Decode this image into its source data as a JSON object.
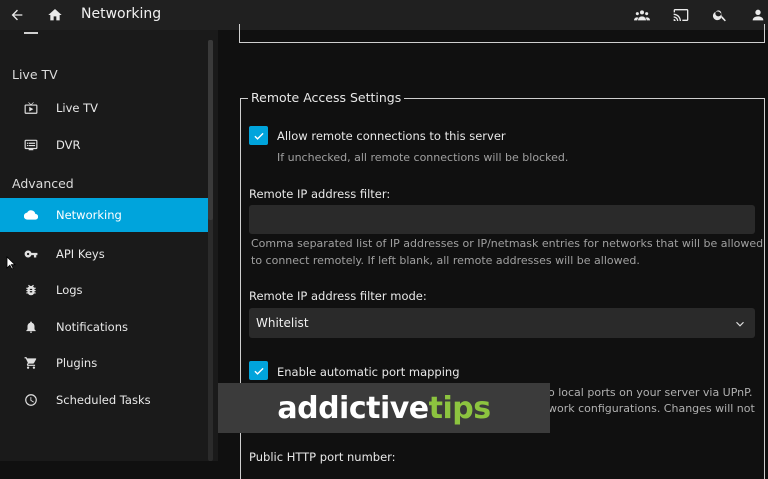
{
  "header": {
    "title": "Networking"
  },
  "sidebar": {
    "sections": [
      {
        "label": "Live TV"
      },
      {
        "label": "Advanced"
      }
    ],
    "items": [
      {
        "label": "Live TV",
        "icon": "live-tv-icon"
      },
      {
        "label": "DVR",
        "icon": "dvr-icon"
      },
      {
        "label": "Networking",
        "icon": "cloud-icon"
      },
      {
        "label": "API Keys",
        "icon": "key-icon"
      },
      {
        "label": "Logs",
        "icon": "bug-icon"
      },
      {
        "label": "Notifications",
        "icon": "bell-icon"
      },
      {
        "label": "Plugins",
        "icon": "cart-icon"
      },
      {
        "label": "Scheduled Tasks",
        "icon": "clock-icon"
      }
    ]
  },
  "remote_access": {
    "legend": "Remote Access Settings",
    "allow_remote_label": "Allow remote connections to this server",
    "allow_remote_checked": true,
    "allow_remote_help": "If unchecked, all remote connections will be blocked.",
    "ip_filter_label": "Remote IP address filter:",
    "ip_filter_value": "",
    "ip_filter_help_1": "Comma separated list of IP addresses or IP/netmask entries for networks that will be allowed",
    "ip_filter_help_2": "to connect remotely. If left blank, all remote addresses will be allowed.",
    "ip_filter_mode_label": "Remote IP address filter mode:",
    "ip_filter_mode_value": "Whitelist",
    "port_mapping_label": "Enable automatic port mapping",
    "port_mapping_checked": true,
    "port_mapping_help_1": "o local ports on your server via UPnP.",
    "port_mapping_help_2": "work configurations. Changes will not",
    "http_port_label": "Public HTTP port number:"
  },
  "watermark": {
    "part1": "addictive",
    "part2": "tips"
  },
  "colors": {
    "accent": "#00a4dc",
    "watermark_green": "#8cc43f"
  }
}
